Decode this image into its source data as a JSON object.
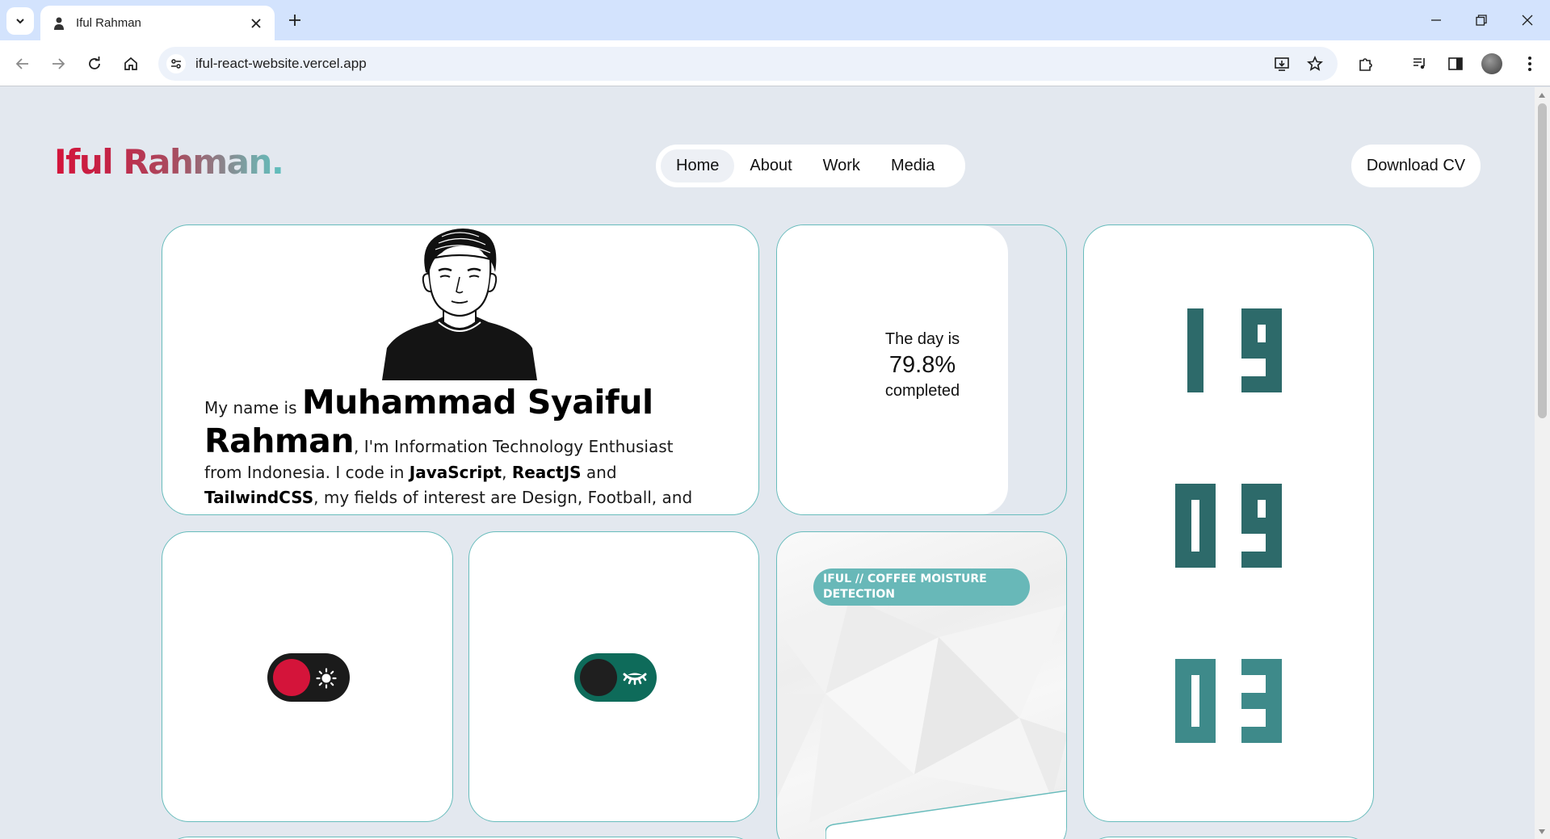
{
  "browser": {
    "tab_title": "Iful Rahman",
    "url": "iful-react-website.vercel.app"
  },
  "header": {
    "logo": "Iful Rahman.",
    "nav": [
      "Home",
      "About",
      "Work",
      "Media"
    ],
    "active_nav": "Home",
    "cv_button": "Download CV"
  },
  "about": {
    "intro": "My name is ",
    "name": "Muhammad Syaiful Rahman",
    "text1": ", I'm Information Technology Enthusiast from Indonesia. I code in ",
    "skill1": "JavaScript",
    "sep1": ", ",
    "skill2": "ReactJS",
    "sep2": " and ",
    "skill3": "TailwindCSS",
    "text2": ", my fields of interest are Design, Football, and Music."
  },
  "day_progress": {
    "line1": "The day is",
    "percent": "79.8%",
    "line3": "completed",
    "fraction": 0.798
  },
  "clock": {
    "hours": "19",
    "minutes": "09",
    "seconds": "03"
  },
  "project": {
    "tag": "IFUL // COFFEE MOISTURE DETECTION"
  },
  "colors": {
    "accent": "#68bcbc",
    "brand_red": "#d4143a",
    "clock_dark": "#2d6a6a",
    "clock_light": "#3e8a8a",
    "toggle_green": "#0e6b5a"
  }
}
